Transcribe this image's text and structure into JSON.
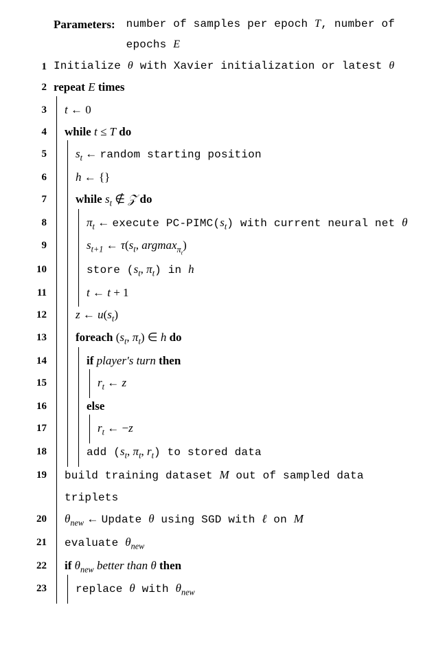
{
  "params": {
    "label": "Parameters:",
    "text_a": "number of samples per epoch ",
    "T": "T",
    "text_b": ", number of epochs ",
    "E": "E"
  },
  "lines": {
    "l1": {
      "n": "1",
      "a": "Initialize ",
      "theta": "θ",
      "b": " with Xavier initialization or latest ",
      "theta2": "θ"
    },
    "l2": {
      "n": "2",
      "kw": "repeat ",
      "E": "E",
      "kw2": " times"
    },
    "l3": {
      "n": "3",
      "t": "t",
      "arrow": " ← 0"
    },
    "l4": {
      "n": "4",
      "kw": "while ",
      "cond_a": "t ≤ T",
      "kw2": " do"
    },
    "l5": {
      "n": "5",
      "s": "s",
      "sub": "t",
      "arrow": " ← ",
      "txt": "random starting position"
    },
    "l6": {
      "n": "6",
      "h": "h",
      "arrow": " ← {}"
    },
    "l7": {
      "n": "7",
      "kw": "while ",
      "s": "s",
      "sub": "t",
      "notin": " ∉ ",
      "Z": "𝒵",
      "kw2": " do"
    },
    "l8": {
      "n": "8",
      "pi": "π",
      "sub": "t",
      "arrow": " ← ",
      "txt": "execute PC-PIMC(",
      "s": "s",
      "sub2": "t",
      "close": ") with current neural net ",
      "theta": "θ"
    },
    "l9": {
      "n": "9",
      "s": "s",
      "sub": "t+1",
      "arrow": " ← ",
      "tau": "τ",
      "open": "(",
      "s2": "s",
      "sub2": "t",
      "comma": ", ",
      "argmax": "argmax",
      "sub3": "π",
      "sub3b": "t",
      "close": ")"
    },
    "l10": {
      "n": "10",
      "txt": "store (",
      "s": "s",
      "sub": "t",
      "comma": ", ",
      "pi": "π",
      "sub2": "t",
      "close": ") in ",
      "h": "h"
    },
    "l11": {
      "n": "11",
      "t": "t",
      "arrow": " ← ",
      "t2": "t",
      "plus": " + 1"
    },
    "l12": {
      "n": "12",
      "z": "z",
      "arrow": " ← ",
      "u": "u",
      "open": "(",
      "s": "s",
      "sub": "t",
      "close": ")"
    },
    "l13": {
      "n": "13",
      "kw": "foreach ",
      "open": "(",
      "s": "s",
      "sub": "t",
      "comma": ", ",
      "pi": "π",
      "sub2": "t",
      "close": ") ∈ ",
      "h": "h",
      "kw2": " do"
    },
    "l14": {
      "n": "14",
      "kw": "if ",
      "cond": "player's turn",
      "kw2": " then"
    },
    "l15": {
      "n": "15",
      "r": "r",
      "sub": "t",
      "arrow": " ← ",
      "z": "z"
    },
    "l16": {
      "n": "16",
      "kw": "else"
    },
    "l17": {
      "n": "17",
      "r": "r",
      "sub": "t",
      "arrow": " ← −",
      "z": "z"
    },
    "l18": {
      "n": "18",
      "txt": "add (",
      "s": "s",
      "sub": "t",
      "c1": ", ",
      "pi": "π",
      "sub2": "t",
      "c2": ", ",
      "r": "r",
      "sub3": "t",
      "close": ") to stored data"
    },
    "l19": {
      "n": "19",
      "txt": "build training dataset ",
      "M": "M",
      "txt2": " out of sampled data triplets"
    },
    "l20": {
      "n": "20",
      "theta": "θ",
      "sub": "new",
      "arrow": " ← ",
      "txt": "Update ",
      "theta2": "θ",
      "txt2": " using SGD with ",
      "ell": "ℓ",
      "txt3": " on ",
      "M": "M"
    },
    "l21": {
      "n": "21",
      "txt": "evaluate ",
      "theta": "θ",
      "sub": "new"
    },
    "l22": {
      "n": "22",
      "kw": "if ",
      "theta": "θ",
      "sub": "new",
      "txt": " better than ",
      "theta2": "θ",
      "kw2": " then"
    },
    "l23": {
      "n": "23",
      "txt": "replace ",
      "theta": "θ",
      "txt2": " with ",
      "theta2": "θ",
      "sub": "new"
    }
  }
}
